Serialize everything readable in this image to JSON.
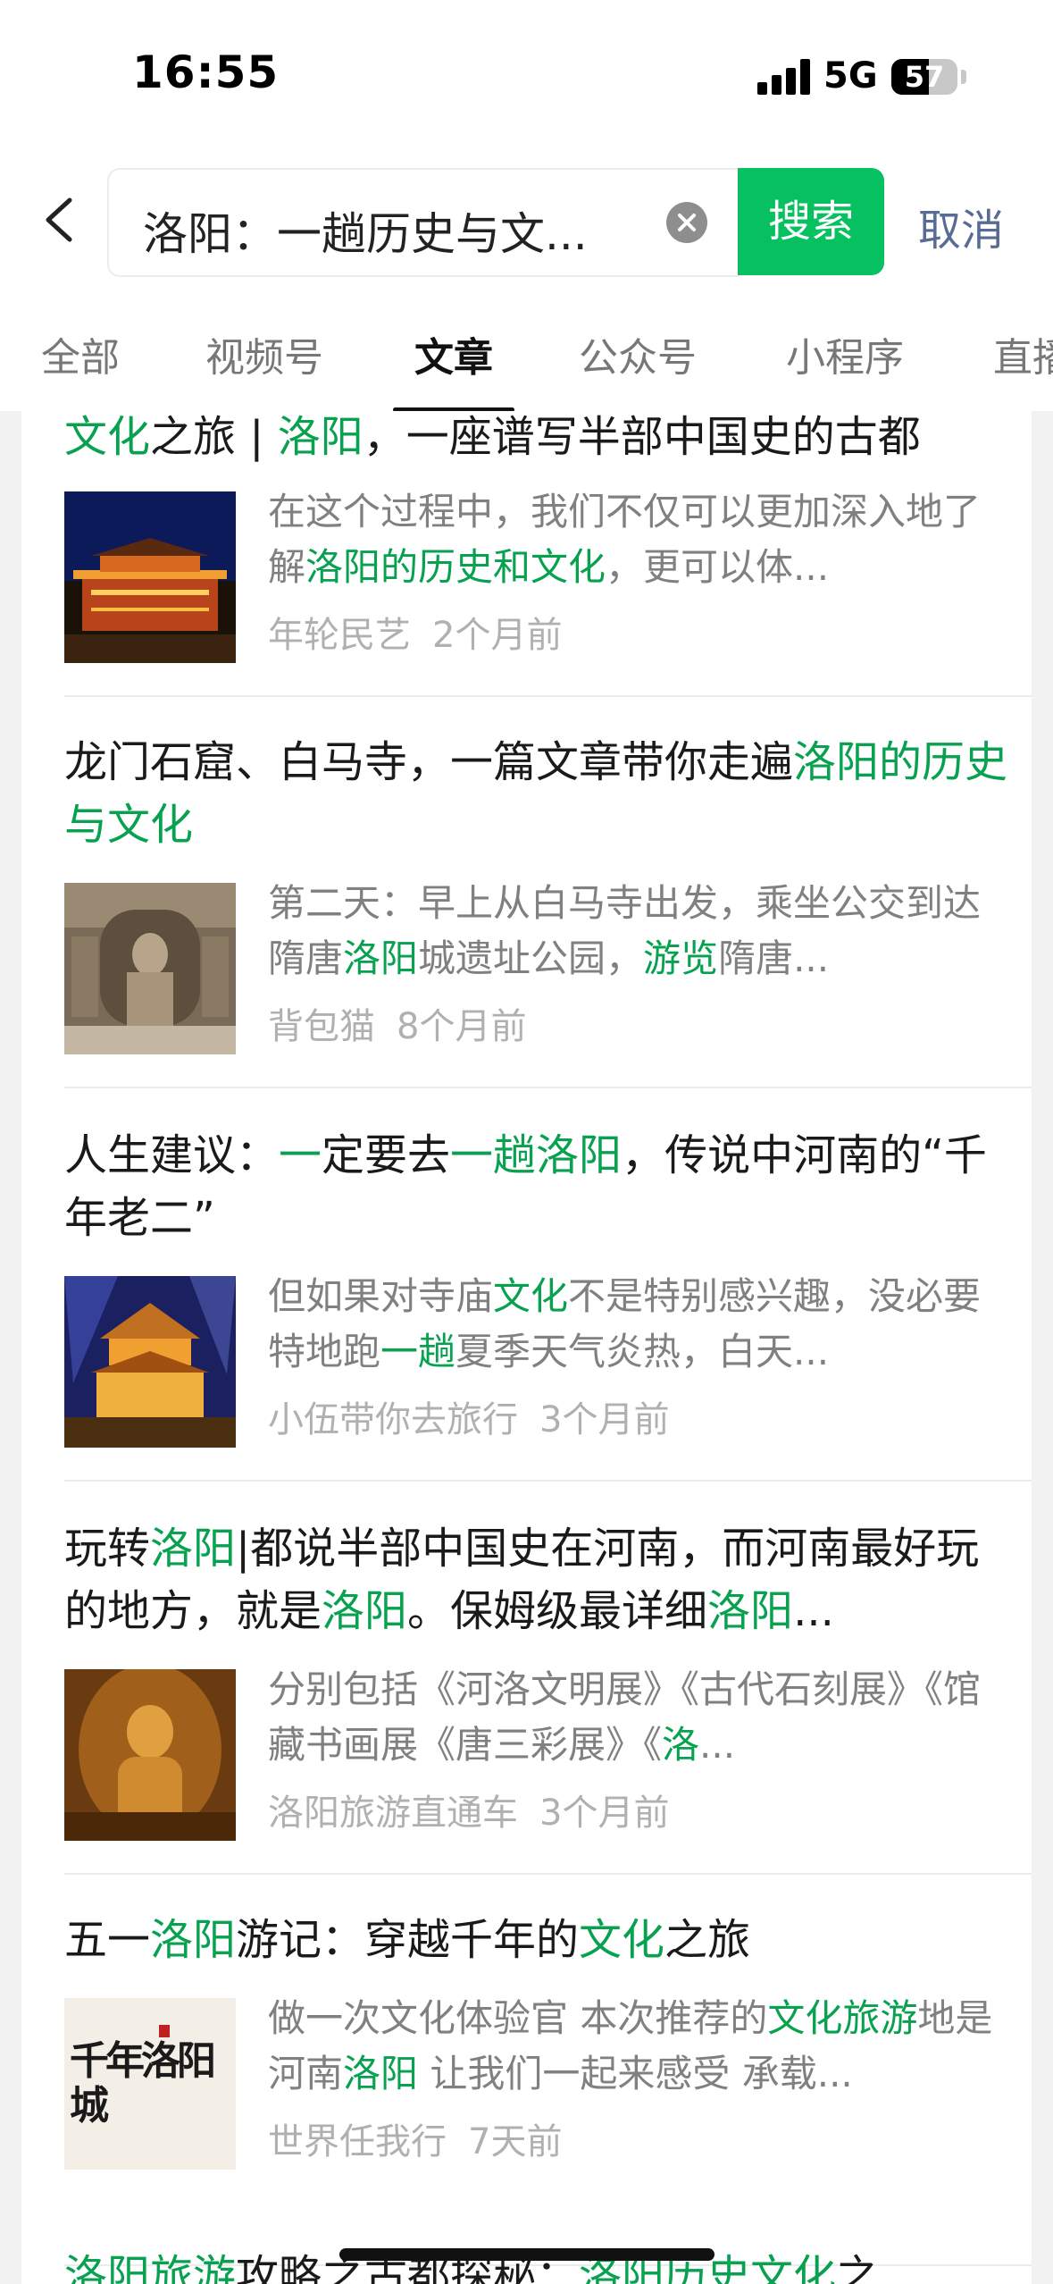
{
  "status": {
    "time": "16:55",
    "network": "5G",
    "battery": "57",
    "battery_level": 0.57
  },
  "search": {
    "query": "洛阳：一趟历史与文...",
    "button": "搜索",
    "cancel": "取消"
  },
  "tabs": [
    "全部",
    "视频号",
    "文章",
    "公众号",
    "小程序",
    "直播"
  ],
  "active_tab": "文章",
  "articles": [
    {
      "title": [
        {
          "text": "文化",
          "hl": true
        },
        {
          "text": "之旅 | ",
          "hl": false
        },
        {
          "text": "洛阳",
          "hl": true
        },
        {
          "text": "，一座谱写半部中国史的古都",
          "hl": false
        }
      ],
      "snippet": [
        {
          "text": "在这个过程中，我们不仅可以更加深入地了解",
          "hl": false
        },
        {
          "text": "洛阳的历史和文化",
          "hl": true
        },
        {
          "text": "，更可以体...",
          "hl": false
        }
      ],
      "source": "年轮民艺",
      "time": "2个月前",
      "thumb_icon": "night-palace-image"
    },
    {
      "title": [
        {
          "text": "龙门石窟、白马寺，一篇文章带你走遍",
          "hl": false
        },
        {
          "text": "洛阳的历史与文化",
          "hl": true
        }
      ],
      "snippet": [
        {
          "text": "第二天：早上从白马寺出发，乘坐公交到达隋唐",
          "hl": false
        },
        {
          "text": "洛阳",
          "hl": true
        },
        {
          "text": "城遗址公园，",
          "hl": false
        },
        {
          "text": "游览",
          "hl": true
        },
        {
          "text": "隋唐...",
          "hl": false
        }
      ],
      "source": "背包猫",
      "time": "8个月前",
      "thumb_icon": "grotto-buddha-image"
    },
    {
      "title": [
        {
          "text": "人生建议：",
          "hl": false
        },
        {
          "text": "一",
          "hl": true
        },
        {
          "text": "定要去",
          "hl": false
        },
        {
          "text": "一趟洛阳",
          "hl": true
        },
        {
          "text": "，传说中河南的“千年老二”",
          "hl": false
        }
      ],
      "snippet": [
        {
          "text": "但如果对寺庙",
          "hl": false
        },
        {
          "text": "文化",
          "hl": true
        },
        {
          "text": "不是特别感兴趣，没必要特地跑",
          "hl": false
        },
        {
          "text": "一趟",
          "hl": true
        },
        {
          "text": "夏季天气炎热，白天...",
          "hl": false
        }
      ],
      "source": "小伍带你去旅行",
      "time": "3个月前",
      "thumb_icon": "lit-pagoda-image"
    },
    {
      "title": [
        {
          "text": "玩转",
          "hl": false
        },
        {
          "text": "洛阳",
          "hl": true
        },
        {
          "text": "|都说半部中国史在河南，而河南最好玩的地方，就是",
          "hl": false
        },
        {
          "text": "洛阳",
          "hl": true
        },
        {
          "text": "。保姆级最详细",
          "hl": false
        },
        {
          "text": "洛阳",
          "hl": true
        },
        {
          "text": "...",
          "hl": false
        }
      ],
      "snippet": [
        {
          "text": "分别包括《河洛文明展》《古代石刻展》《馆藏书画展《唐三彩展》《",
          "hl": false
        },
        {
          "text": "洛",
          "hl": true
        },
        {
          "text": "...",
          "hl": false
        }
      ],
      "source": "洛阳旅游直通车",
      "time": "3个月前",
      "thumb_icon": "golden-buddha-image"
    },
    {
      "title": [
        {
          "text": "五一",
          "hl": false
        },
        {
          "text": "洛阳",
          "hl": true
        },
        {
          "text": "游记：穿越千年的",
          "hl": false
        },
        {
          "text": "文化",
          "hl": true
        },
        {
          "text": "之旅",
          "hl": false
        }
      ],
      "snippet": [
        {
          "text": "做一次文化体验官 本次推荐的",
          "hl": false
        },
        {
          "text": "文化旅游",
          "hl": true
        },
        {
          "text": "地是河南",
          "hl": false
        },
        {
          "text": "洛阳",
          "hl": true
        },
        {
          "text": " 让我们一起来感受 承载...",
          "hl": false
        }
      ],
      "source": "世界任我行",
      "time": "7天前",
      "thumb_icon": "calligraphy-poster-image",
      "thumb_text": "千年洛阳城"
    },
    {
      "title": [
        {
          "text": "洛阳旅游",
          "hl": true
        },
        {
          "text": "攻略之古都探秘：",
          "hl": false
        },
        {
          "text": "洛阳历史文化",
          "hl": true
        },
        {
          "text": "之",
          "hl": false
        }
      ]
    }
  ],
  "colors": {
    "accent": "#07c160",
    "highlight": "#07a150",
    "cancel": "#576b95",
    "meta": "#b0b0b0"
  }
}
